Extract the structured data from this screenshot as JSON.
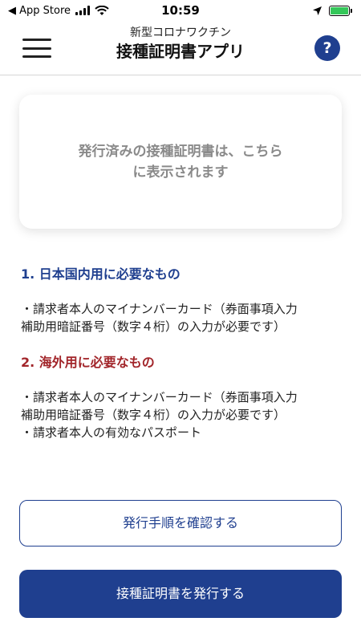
{
  "status_bar": {
    "back_label": "◀ App Store",
    "time": "10:59"
  },
  "header": {
    "subtitle": "新型コロナワクチン",
    "title": "接種証明書アプリ",
    "help_label": "?"
  },
  "certificate_card": {
    "line1": "発行済みの接種証明書は、こちら",
    "line2": "に表示されます"
  },
  "domestic": {
    "heading": "1. 日本国内用に必要なもの",
    "items": [
      "・請求者本人のマイナンバーカード（券面事項入力",
      "補助用暗証番号（数字４桁）の入力が必要です）"
    ]
  },
  "overseas": {
    "heading": "2. 海外用に必要なもの",
    "items": [
      "・請求者本人のマイナンバーカード（券面事項入力",
      "補助用暗証番号（数字４桁）の入力が必要です）",
      "・請求者本人の有効なパスポート"
    ]
  },
  "buttons": {
    "check_procedure": "発行手順を確認する",
    "issue_certificate": "接種証明書を発行する"
  },
  "colors": {
    "accent_blue": "#1f3f8f",
    "accent_red": "#a2252a",
    "battery_green": "#34c759"
  },
  "icons": {
    "signal": "cellular-signal-icon",
    "wifi": "wifi-icon",
    "location": "location-arrow-icon",
    "battery": "battery-charging-icon",
    "menu": "hamburger-menu-icon",
    "help": "question-mark-icon"
  }
}
